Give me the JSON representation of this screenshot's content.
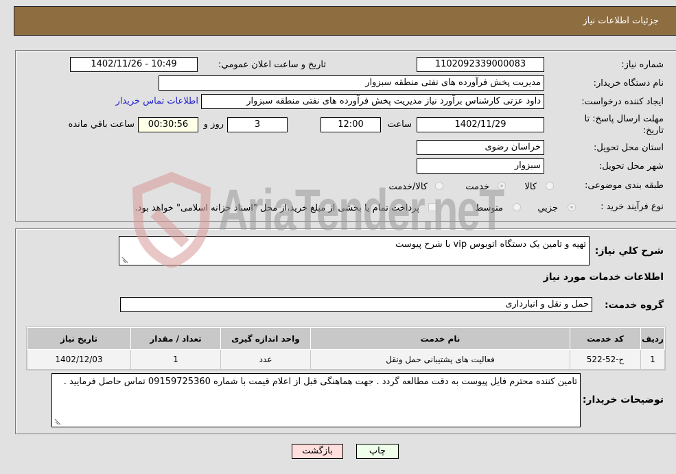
{
  "header": {
    "title": "جزئیات اطلاعات نیاز"
  },
  "details": {
    "need_number_label": "شماره نیاز:",
    "need_number": "1102092339000083",
    "announce_label": "تاریخ و ساعت اعلان عمومي:",
    "announce_value": "1402/11/26 - 10:49",
    "buyer_org_label": "نام دستگاه خریدار:",
    "buyer_org": "مدیریت پخش فرآورده های نفتی منطقه سبزوار",
    "creator_label": "ایجاد کننده درخواست:",
    "creator": "داود عزتی کارشناس برآورد نیاز مدیریت پخش فرآورده های نفتی منطقه سبزوار",
    "contact_link": "اطلاعات تماس خریدار",
    "deadline_label_1": "مهلت ارسال پاسخ: تا",
    "deadline_label_2": "تاریخ:",
    "deadline_date": "1402/11/29",
    "time_label": "ساعت",
    "deadline_time": "12:00",
    "days_value": "3",
    "days_label": "روز و",
    "remaining_time": "00:30:56",
    "remaining_label": "ساعت باقي مانده",
    "province_label": "استان محل تحویل:",
    "province": "خراسان رضوی",
    "city_label": "شهر محل تحویل:",
    "city": "سبزوار",
    "category_label": "طبقه بندی موضوعی:",
    "category_options": [
      {
        "label": "کالا",
        "checked": false
      },
      {
        "label": "خدمت",
        "checked": true
      },
      {
        "label": "کالا/خدمت",
        "checked": false
      }
    ],
    "process_label": "نوع فرآیند خرید :",
    "process_options": [
      {
        "label": "جزيي",
        "checked": true
      },
      {
        "label": "متوسط",
        "checked": false
      }
    ],
    "treasury_note": "پرداخت تمام یا بخشی از مبلغ خرید،از محل \"اسناد خزانه اسلامی\" خواهد بود."
  },
  "services": {
    "summary_label": "شرح کلي نیاز:",
    "summary": "تهیه و تامین یک دستگاه اتوبوس vip  با شرح پیوست",
    "section_title": "اطلاعات خدمات مورد نیاز",
    "group_label": "گروه خدمت:",
    "group": "حمل و نقل و انبارداری",
    "table": {
      "headers": [
        "ردیف",
        "کد خدمت",
        "نام خدمت",
        "واحد اندازه گیری",
        "تعداد / مقدار",
        "تاریخ نیاز"
      ],
      "rows": [
        [
          "1",
          "ح-52-522",
          "فعالیت های پشتیبانی حمل ونقل",
          "عدد",
          "1",
          "1402/12/03"
        ]
      ]
    },
    "buyer_notes_label": "توضیحات خریدار:",
    "buyer_notes": "تامین کننده محترم فایل پیوست به دقت مطالعه گردد . جهت هماهنگی قبل از اعلام قیمت با شماره 09159725360 تماس حاصل فرمایید ."
  },
  "buttons": {
    "print": "چاپ",
    "back": "بازگشت"
  },
  "watermark": {
    "text": "AriaTender.neT"
  },
  "colors": {
    "header_bg": "#8e6d41",
    "print_bg": "#efffea",
    "back_bg": "#ffdede",
    "link": "#2222cc"
  }
}
